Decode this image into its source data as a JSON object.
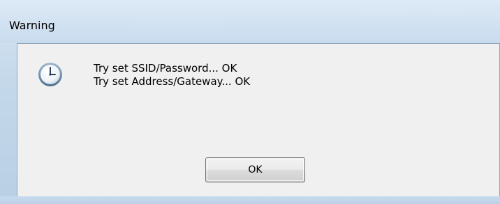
{
  "window": {
    "title": "Warning"
  },
  "dialog": {
    "icon": "clock-icon",
    "message_lines": [
      "Try set SSID/Password... OK",
      "Try set Address/Gateway... OK"
    ],
    "ok_label": "OK"
  },
  "colors": {
    "frame": "#c4d8ea",
    "client_bg": "#f0f0f0",
    "button_border": "#707070"
  }
}
